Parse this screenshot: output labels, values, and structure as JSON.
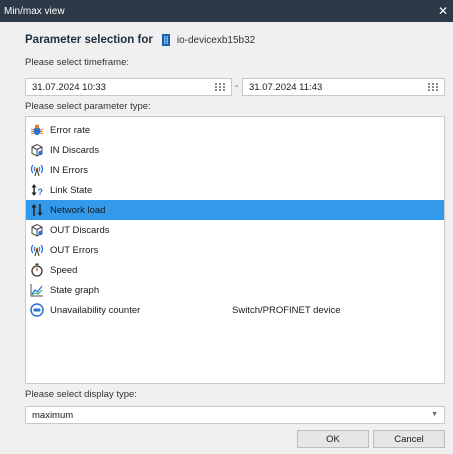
{
  "window": {
    "title": "Min/max view",
    "close_glyph": "✕"
  },
  "heading": {
    "label": "Parameter selection for",
    "device_name": "io-devicexb15b32",
    "device_icon": "network-device-icon"
  },
  "timeframe": {
    "label": "Please select timeframe:",
    "from": "31.07.2024 10:33",
    "separator": "-",
    "to": "31.07.2024 11:43"
  },
  "parameter_type": {
    "label": "Please select parameter type:",
    "items": [
      {
        "label": "Error rate",
        "icon": "bug-icon",
        "extra": ""
      },
      {
        "label": "IN Discards",
        "icon": "box-discard-icon",
        "extra": ""
      },
      {
        "label": "IN Errors",
        "icon": "antenna-error-icon",
        "extra": ""
      },
      {
        "label": "Link State",
        "icon": "link-state-icon",
        "extra": ""
      },
      {
        "label": "Network load",
        "icon": "network-load-icon",
        "extra": "",
        "selected": true
      },
      {
        "label": "OUT Discards",
        "icon": "box-discard-icon",
        "extra": ""
      },
      {
        "label": "OUT Errors",
        "icon": "antenna-error-icon",
        "extra": ""
      },
      {
        "label": "Speed",
        "icon": "stopwatch-icon",
        "extra": ""
      },
      {
        "label": "State graph",
        "icon": "line-graph-icon",
        "extra": ""
      },
      {
        "label": "Unavailability counter",
        "icon": "counter-badge-icon",
        "extra": "Switch/PROFINET device"
      }
    ]
  },
  "display_type": {
    "label": "Please select display type:",
    "value": "maximum"
  },
  "buttons": {
    "ok": "OK",
    "cancel": "Cancel"
  },
  "colors": {
    "titlebar": "#2c3a47",
    "selection": "#3399ea",
    "accent_icon": "#1e5fb4"
  }
}
